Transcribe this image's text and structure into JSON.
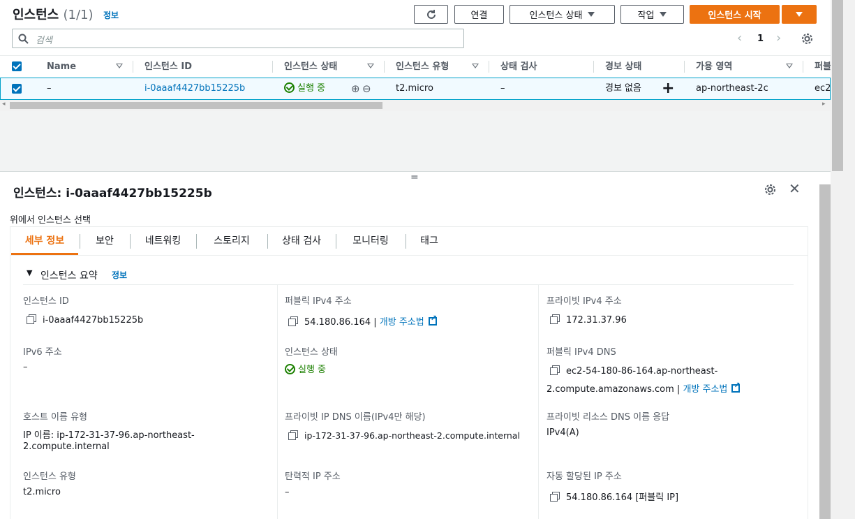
{
  "header": {
    "title": "인스턴스",
    "count": "(1/1)",
    "info_link": "정보",
    "refresh_label": "",
    "connect_label": "연결",
    "instance_state_label": "인스턴스 상태",
    "actions_label": "작업",
    "launch_label": "인스턴스 시작"
  },
  "search": {
    "placeholder": "검색"
  },
  "pagination": {
    "page": "1"
  },
  "table": {
    "columns": [
      "Name",
      "인스턴스 ID",
      "인스턴스 상태",
      "인스턴스 유형",
      "상태 검사",
      "경보 상태",
      "가용 영역",
      "퍼블"
    ],
    "row": {
      "name": "–",
      "instance_id": "i-0aaaf4427bb15225b",
      "state": "실행 중",
      "type": "t2.micro",
      "status_check": "–",
      "alarm": "경보 없음",
      "az": "ap-northeast-2c",
      "public": "ec2"
    }
  },
  "details": {
    "title": "인스턴스: i-0aaaf4427bb15225b",
    "subtitle": "위에서 인스턴스 선택",
    "tabs": [
      "세부 정보",
      "보안",
      "네트워킹",
      "스토리지",
      "상태 검사",
      "모니터링",
      "태그"
    ],
    "active_tab": "세부 정보",
    "section_title": "인스턴스 요약",
    "section_info": "정보",
    "fields": {
      "instance_id_label": "인스턴스 ID",
      "instance_id_value": "i-0aaaf4427bb15225b",
      "public_ipv4_label": "퍼블릭 IPv4 주소",
      "public_ipv4_value": "54.180.86.164",
      "open_address_link": "개방 주소법",
      "private_ipv4_label": "프라이빗 IPv4 주소",
      "private_ipv4_value": "172.31.37.96",
      "ipv6_label": "IPv6 주소",
      "ipv6_value": "–",
      "instance_state_label": "인스턴스 상태",
      "instance_state_value": "실행 중",
      "public_dns_label": "퍼블릭 IPv4 DNS",
      "public_dns_value_1": "ec2-54-180-86-164.ap-northeast-",
      "public_dns_value_2": "2.compute.amazonaws.com",
      "hostname_type_label": "호스트 이름 유형",
      "hostname_type_value_1": "IP 이름: ip-172-31-37-96.ap-northeast-",
      "hostname_type_value_2": "2.compute.internal",
      "private_dns_label": "프라이빗 IP DNS 이름(IPv4만 해당)",
      "private_dns_value": "ip-172-31-37-96.ap-northeast-2.compute.internal",
      "private_resource_dns_label": "프라이빗 리소스 DNS 이름 응답",
      "private_resource_dns_value": "IPv4(A)",
      "instance_type_label": "인스턴스 유형",
      "instance_type_value": "t2.micro",
      "elastic_ip_label": "탄력적 IP 주소",
      "elastic_ip_value": "–",
      "auto_ip_label": "자동 할당된 IP 주소",
      "auto_ip_value": "54.180.86.164 [퍼블릭 IP]"
    }
  },
  "colors": {
    "accent": "#ec7211",
    "link": "#0073bb",
    "success": "#1d8102",
    "selected_row": "#f1faff"
  }
}
